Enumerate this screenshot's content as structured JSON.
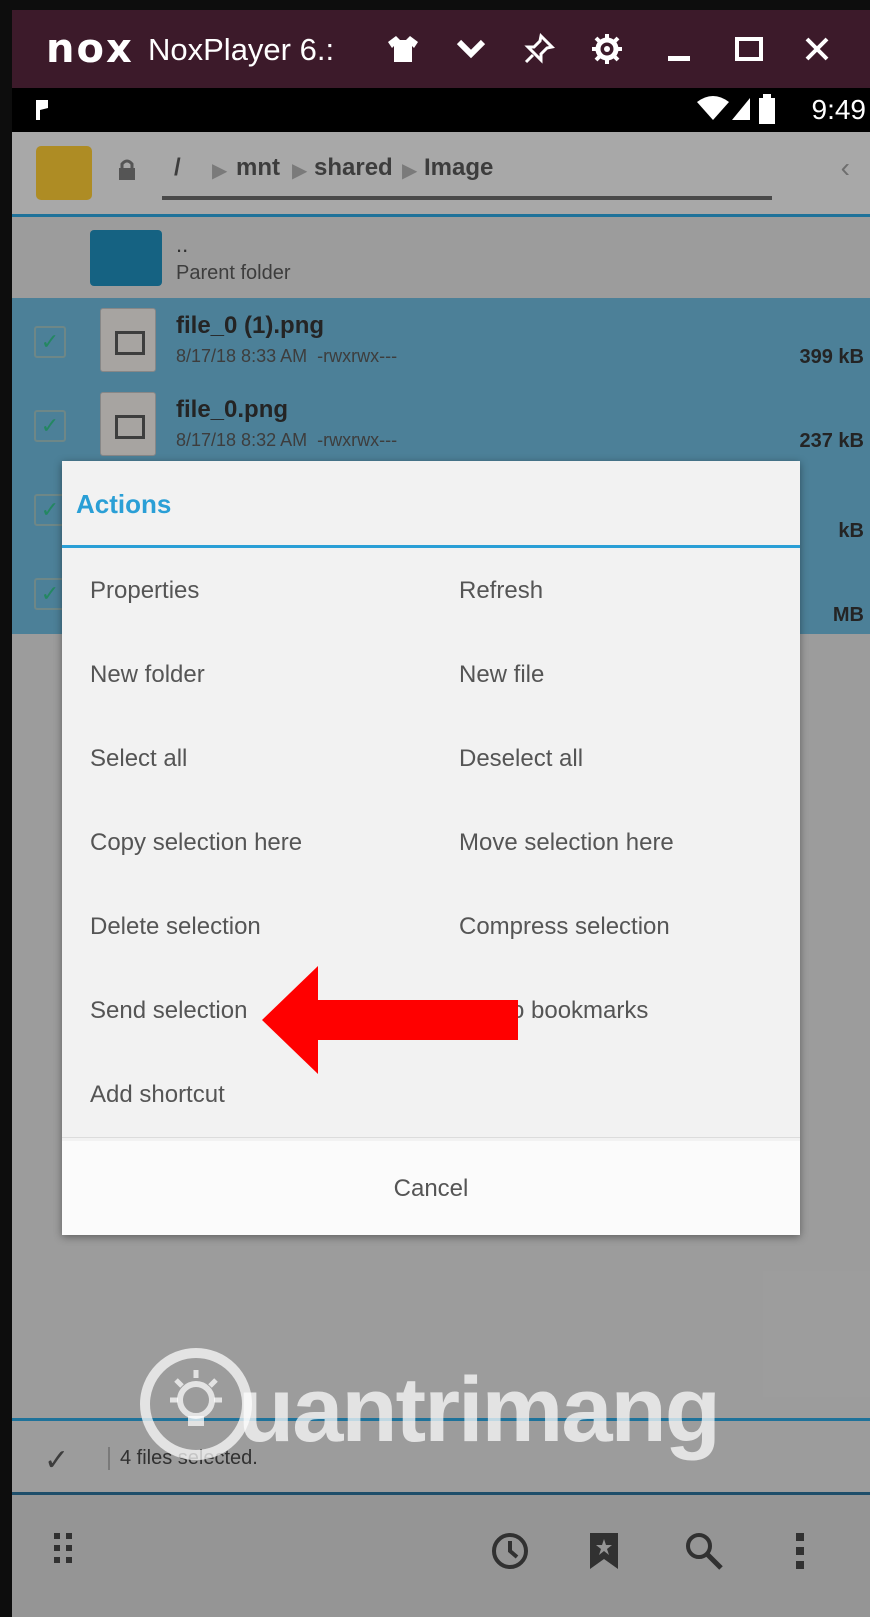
{
  "window": {
    "logo": "nox",
    "title": "NoxPlayer 6.:",
    "icons": [
      "shirt-icon",
      "chevron-down-icon",
      "pin-icon",
      "settings-gear-icon",
      "minimize-icon",
      "maximize-icon",
      "close-icon"
    ]
  },
  "status_bar": {
    "time": "9:49",
    "icons": [
      "notification-icon",
      "wifi-icon",
      "signal-icon",
      "battery-icon"
    ]
  },
  "path": {
    "crumbs": [
      "/",
      "mnt",
      "shared",
      "Image"
    ]
  },
  "files": {
    "parent": {
      "name": "..",
      "label": "Parent folder"
    },
    "items": [
      {
        "name": "file_0 (1).png",
        "date": "8/17/18 8:33 AM",
        "perms": "-rwxrwx---",
        "size": "399 kB"
      },
      {
        "name": "file_0.png",
        "date": "8/17/18 8:32 AM",
        "perms": "-rwxrwx---",
        "size": "237 kB"
      },
      {
        "size": "kB"
      },
      {
        "size": "MB"
      }
    ]
  },
  "dialog": {
    "title": "Actions",
    "actions": [
      [
        "Properties",
        "Refresh"
      ],
      [
        "New folder",
        "New file"
      ],
      [
        "Select all",
        "Deselect all"
      ],
      [
        "Copy selection here",
        "Move selection here"
      ],
      [
        "Delete selection",
        "Compress selection"
      ],
      [
        "Send selection",
        "o bookmarks"
      ],
      [
        "Add shortcut",
        ""
      ]
    ],
    "cancel": "Cancel"
  },
  "selection_bar": {
    "text": "4 files selected."
  },
  "watermark": {
    "text": "uantrimang"
  },
  "colors": {
    "accent": "#2a9fd6",
    "arrow": "#ff0000",
    "title_bar": "#3c1a2a"
  }
}
